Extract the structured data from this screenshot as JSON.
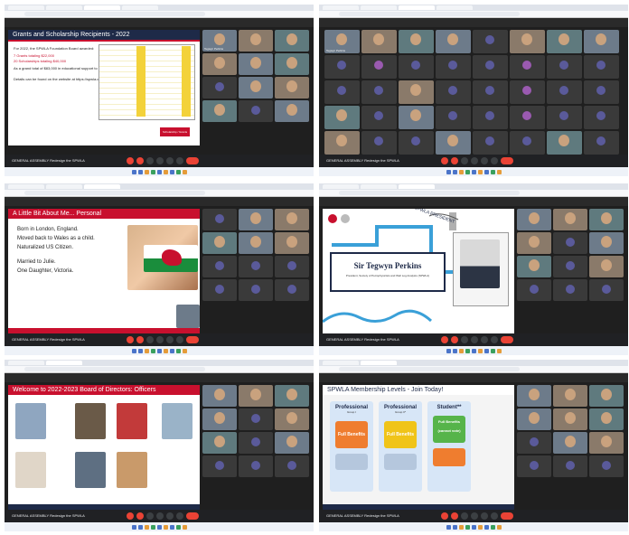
{
  "shots": {
    "s1": {
      "slide_title": "Grants and Scholarship Recipients - 2022",
      "text_lines": [
        "For 2022, the SPWLA Foundation Board awarded:",
        "7 Grants totaling $22,000",
        "20 Scholarships totaling $40,000",
        "As a grand total of $83,000 in educational support to students at the following schools:",
        "Details can be found on the website at https://spwla.org"
      ],
      "note": "Scholarship / Grants",
      "tiles": [
        "Tegwyn Perkins",
        "",
        "",
        "",
        "",
        "",
        "",
        "",
        "",
        "",
        "",
        ""
      ],
      "meeting": "GENERAL ASSEMBLY Redesign the SPWLA"
    },
    "s2": {
      "tiles": [
        "Tegwyn Perkins",
        "",
        "",
        "",
        "",
        "",
        "",
        "",
        "",
        "",
        "",
        "",
        "",
        "",
        "",
        "",
        "",
        "",
        "",
        "",
        "",
        "",
        "",
        "",
        "",
        "",
        "",
        "",
        "",
        "",
        "",
        "",
        "",
        "",
        "",
        "",
        "",
        "",
        "",
        ""
      ],
      "meeting": "GENERAL ASSEMBLY Redesign the SPWLA"
    },
    "s3": {
      "slide_title": "A Little Bit About Me... Personal",
      "bullets": [
        "Born in London, England.",
        "Moved back to Wales as a child.",
        "Naturalized US Citizen.",
        "Married to Julie.",
        "One Daughter, Victoria."
      ],
      "meeting": "GENERAL ASSEMBLY Redesign the SPWLA"
    },
    "s4": {
      "name": "Sir Tegwyn Perkins",
      "subtitle": "President, Society of Petrophysicists and Well Log Analysts (SPWLA)",
      "arc": "SPWLA PRESIDENT",
      "meeting": "GENERAL ASSEMBLY Redesign the SPWLA"
    },
    "s5": {
      "slide_title": "Welcome to 2022-2023 Board of Directors: Officers",
      "meeting": "GENERAL ASSEMBLY Redesign the SPWLA"
    },
    "s6": {
      "slide_title": "SPWLA Membership Levels - Join Today!",
      "cards": [
        {
          "head": "Professional",
          "sub": "Group I",
          "body": "Full Benefits"
        },
        {
          "head": "Professional",
          "sub": "Group II*",
          "body": "Full Benefits"
        },
        {
          "head": "Student**",
          "sub": "",
          "body": "Full Benefits (cannot vote)"
        }
      ],
      "meeting": "GENERAL ASSEMBLY Redesign the SPWLA"
    }
  },
  "colors": {
    "accent_red": "#c8102e",
    "navy": "#1e2a48",
    "end_call": "#ea4335"
  }
}
